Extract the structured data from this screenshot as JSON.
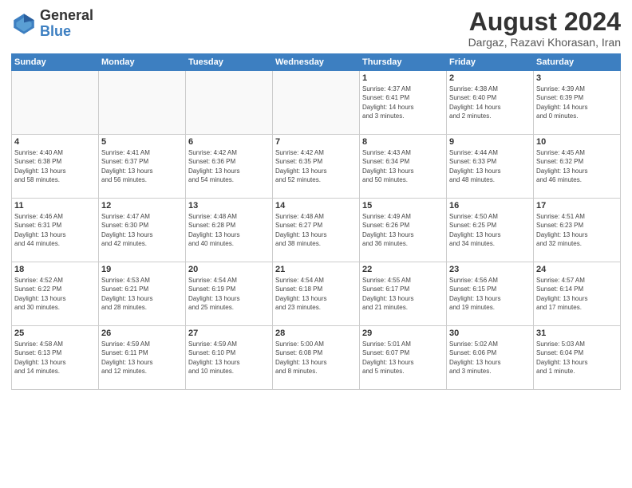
{
  "header": {
    "logo_line1": "General",
    "logo_line2": "Blue",
    "month_year": "August 2024",
    "location": "Dargaz, Razavi Khorasan, Iran"
  },
  "days_of_week": [
    "Sunday",
    "Monday",
    "Tuesday",
    "Wednesday",
    "Thursday",
    "Friday",
    "Saturday"
  ],
  "weeks": [
    [
      {
        "day": "",
        "info": ""
      },
      {
        "day": "",
        "info": ""
      },
      {
        "day": "",
        "info": ""
      },
      {
        "day": "",
        "info": ""
      },
      {
        "day": "1",
        "info": "Sunrise: 4:37 AM\nSunset: 6:41 PM\nDaylight: 14 hours\nand 3 minutes."
      },
      {
        "day": "2",
        "info": "Sunrise: 4:38 AM\nSunset: 6:40 PM\nDaylight: 14 hours\nand 2 minutes."
      },
      {
        "day": "3",
        "info": "Sunrise: 4:39 AM\nSunset: 6:39 PM\nDaylight: 14 hours\nand 0 minutes."
      }
    ],
    [
      {
        "day": "4",
        "info": "Sunrise: 4:40 AM\nSunset: 6:38 PM\nDaylight: 13 hours\nand 58 minutes."
      },
      {
        "day": "5",
        "info": "Sunrise: 4:41 AM\nSunset: 6:37 PM\nDaylight: 13 hours\nand 56 minutes."
      },
      {
        "day": "6",
        "info": "Sunrise: 4:42 AM\nSunset: 6:36 PM\nDaylight: 13 hours\nand 54 minutes."
      },
      {
        "day": "7",
        "info": "Sunrise: 4:42 AM\nSunset: 6:35 PM\nDaylight: 13 hours\nand 52 minutes."
      },
      {
        "day": "8",
        "info": "Sunrise: 4:43 AM\nSunset: 6:34 PM\nDaylight: 13 hours\nand 50 minutes."
      },
      {
        "day": "9",
        "info": "Sunrise: 4:44 AM\nSunset: 6:33 PM\nDaylight: 13 hours\nand 48 minutes."
      },
      {
        "day": "10",
        "info": "Sunrise: 4:45 AM\nSunset: 6:32 PM\nDaylight: 13 hours\nand 46 minutes."
      }
    ],
    [
      {
        "day": "11",
        "info": "Sunrise: 4:46 AM\nSunset: 6:31 PM\nDaylight: 13 hours\nand 44 minutes."
      },
      {
        "day": "12",
        "info": "Sunrise: 4:47 AM\nSunset: 6:30 PM\nDaylight: 13 hours\nand 42 minutes."
      },
      {
        "day": "13",
        "info": "Sunrise: 4:48 AM\nSunset: 6:28 PM\nDaylight: 13 hours\nand 40 minutes."
      },
      {
        "day": "14",
        "info": "Sunrise: 4:48 AM\nSunset: 6:27 PM\nDaylight: 13 hours\nand 38 minutes."
      },
      {
        "day": "15",
        "info": "Sunrise: 4:49 AM\nSunset: 6:26 PM\nDaylight: 13 hours\nand 36 minutes."
      },
      {
        "day": "16",
        "info": "Sunrise: 4:50 AM\nSunset: 6:25 PM\nDaylight: 13 hours\nand 34 minutes."
      },
      {
        "day": "17",
        "info": "Sunrise: 4:51 AM\nSunset: 6:23 PM\nDaylight: 13 hours\nand 32 minutes."
      }
    ],
    [
      {
        "day": "18",
        "info": "Sunrise: 4:52 AM\nSunset: 6:22 PM\nDaylight: 13 hours\nand 30 minutes."
      },
      {
        "day": "19",
        "info": "Sunrise: 4:53 AM\nSunset: 6:21 PM\nDaylight: 13 hours\nand 28 minutes."
      },
      {
        "day": "20",
        "info": "Sunrise: 4:54 AM\nSunset: 6:19 PM\nDaylight: 13 hours\nand 25 minutes."
      },
      {
        "day": "21",
        "info": "Sunrise: 4:54 AM\nSunset: 6:18 PM\nDaylight: 13 hours\nand 23 minutes."
      },
      {
        "day": "22",
        "info": "Sunrise: 4:55 AM\nSunset: 6:17 PM\nDaylight: 13 hours\nand 21 minutes."
      },
      {
        "day": "23",
        "info": "Sunrise: 4:56 AM\nSunset: 6:15 PM\nDaylight: 13 hours\nand 19 minutes."
      },
      {
        "day": "24",
        "info": "Sunrise: 4:57 AM\nSunset: 6:14 PM\nDaylight: 13 hours\nand 17 minutes."
      }
    ],
    [
      {
        "day": "25",
        "info": "Sunrise: 4:58 AM\nSunset: 6:13 PM\nDaylight: 13 hours\nand 14 minutes."
      },
      {
        "day": "26",
        "info": "Sunrise: 4:59 AM\nSunset: 6:11 PM\nDaylight: 13 hours\nand 12 minutes."
      },
      {
        "day": "27",
        "info": "Sunrise: 4:59 AM\nSunset: 6:10 PM\nDaylight: 13 hours\nand 10 minutes."
      },
      {
        "day": "28",
        "info": "Sunrise: 5:00 AM\nSunset: 6:08 PM\nDaylight: 13 hours\nand 8 minutes."
      },
      {
        "day": "29",
        "info": "Sunrise: 5:01 AM\nSunset: 6:07 PM\nDaylight: 13 hours\nand 5 minutes."
      },
      {
        "day": "30",
        "info": "Sunrise: 5:02 AM\nSunset: 6:06 PM\nDaylight: 13 hours\nand 3 minutes."
      },
      {
        "day": "31",
        "info": "Sunrise: 5:03 AM\nSunset: 6:04 PM\nDaylight: 13 hours\nand 1 minute."
      }
    ]
  ]
}
